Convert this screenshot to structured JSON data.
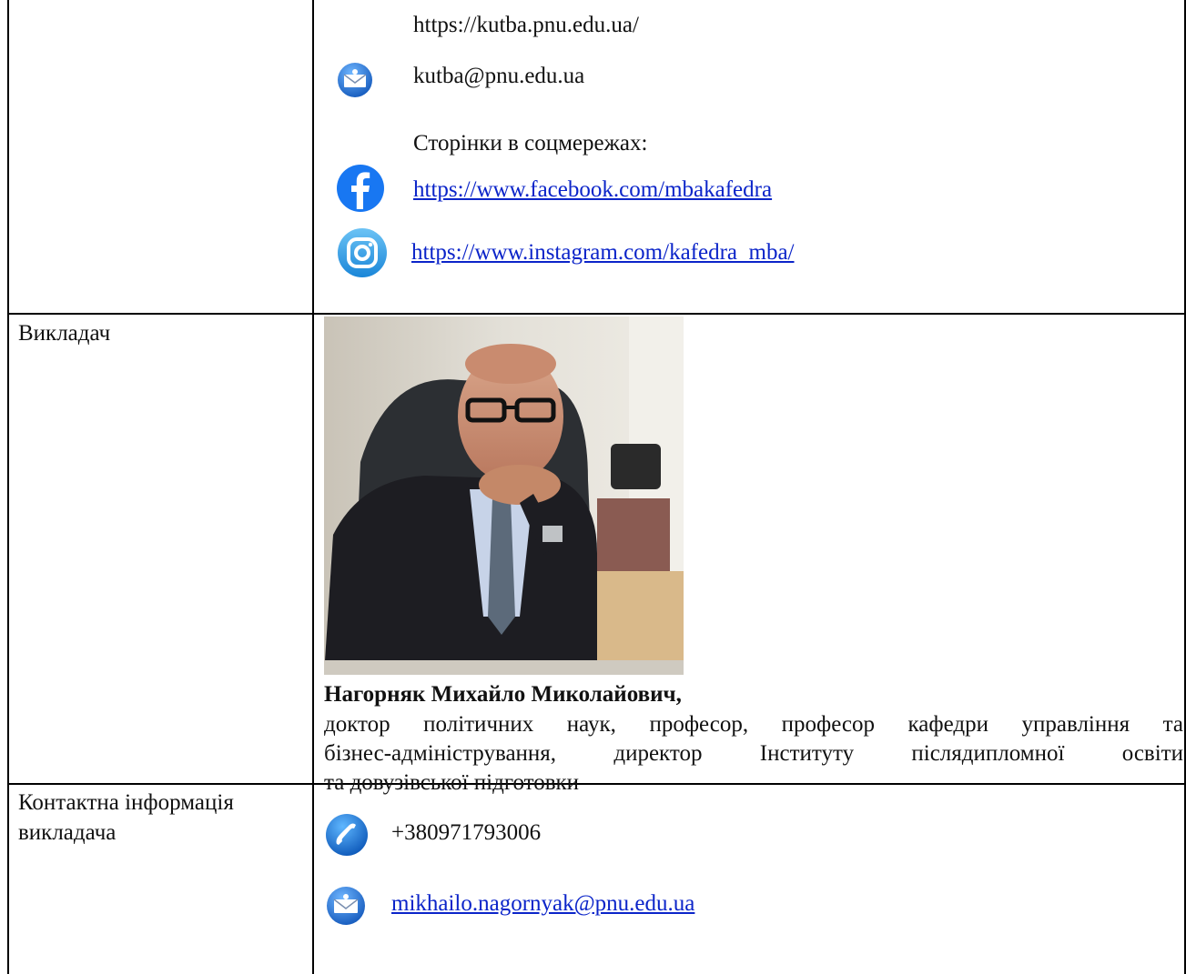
{
  "department": {
    "website": "https://kutba.pnu.edu.ua/",
    "email": "kutba@pnu.edu.ua",
    "social_heading": "Сторінки в соцмережах:",
    "facebook": "https://www.facebook.com/mbakafedra",
    "instagram": "https://www.instagram.com/kafedra_mba/"
  },
  "teacher": {
    "label": "Викладач",
    "name": "Нагорняк Михайло Миколайович,",
    "bio_lines": [
      "доктор політичних наук, професор, професор кафедри управління та",
      "бізнес-адміністрування, директор Інституту післядипломної освіти",
      "та довузівської підготовки"
    ]
  },
  "contacts": {
    "label_line1": "Контактна інформація",
    "label_line2": "викладача",
    "phone": "+380971793006",
    "email": "mikhailo.nagornyak@pnu.edu.ua"
  },
  "icons": {
    "mail": "envelope-icon",
    "facebook": "facebook-icon",
    "instagram": "instagram-icon",
    "phone": "phone-icon"
  },
  "colors": {
    "link": "#0b24c9",
    "facebook_blue": "#1877f2",
    "icon_blue": "#1e7fd6"
  }
}
